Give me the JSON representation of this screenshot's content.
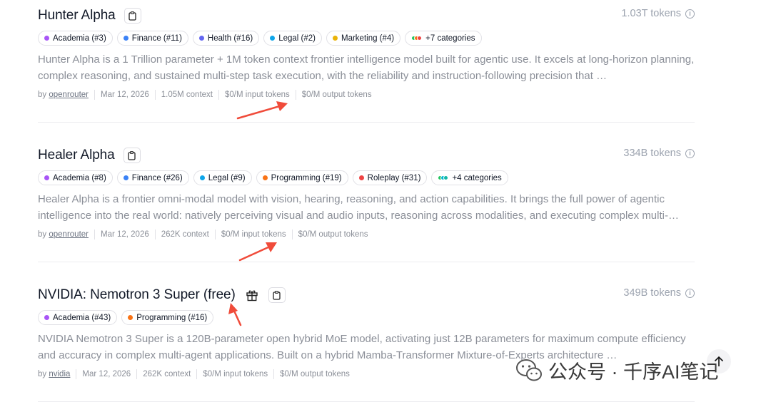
{
  "models": [
    {
      "name": "Hunter Alpha",
      "has_gift_icon": false,
      "tokens": "1.03T tokens",
      "tags": [
        {
          "label": "Academia (#3)",
          "color": "#a855f7"
        },
        {
          "label": "Finance (#11)",
          "color": "#3b82f6"
        },
        {
          "label": "Health (#16)",
          "color": "#6366f1"
        },
        {
          "label": "Legal (#2)",
          "color": "#0ea5e9"
        },
        {
          "label": "Marketing (#4)",
          "color": "#eab308"
        },
        {
          "label": "+7 categories",
          "color": "multi"
        }
      ],
      "description": "Hunter Alpha is a 1 Trillion parameter + 1M token context frontier intelligence model built for agentic use. It excels at long-horizon planning, complex reasoning, and sustained multi-step task execution, with the reliability and instruction-following precision that …",
      "by_label": "by",
      "author": "openrouter",
      "date": "Mar 12, 2026",
      "context": "1.05M context",
      "input_price": "$0/M input tokens",
      "output_price": "$0/M output tokens"
    },
    {
      "name": "Healer Alpha",
      "has_gift_icon": false,
      "tokens": "334B tokens",
      "tags": [
        {
          "label": "Academia (#8)",
          "color": "#a855f7"
        },
        {
          "label": "Finance (#26)",
          "color": "#3b82f6"
        },
        {
          "label": "Legal (#9)",
          "color": "#0ea5e9"
        },
        {
          "label": "Programming (#19)",
          "color": "#f97316"
        },
        {
          "label": "Roleplay (#31)",
          "color": "#ef4444"
        },
        {
          "label": "+4 categories",
          "color": "multi"
        }
      ],
      "description": "Healer Alpha is a frontier omni-modal model with vision, hearing, reasoning, and action capabilities. It brings the full power of agentic intelligence into the real world: natively perceiving visual and audio inputs, reasoning across modalities, and executing complex multi-…",
      "by_label": "by",
      "author": "openrouter",
      "date": "Mar 12, 2026",
      "context": "262K context",
      "input_price": "$0/M input tokens",
      "output_price": "$0/M output tokens"
    },
    {
      "name": "NVIDIA: Nemotron 3 Super (free)",
      "has_gift_icon": true,
      "tokens": "349B tokens",
      "tags": [
        {
          "label": "Academia (#43)",
          "color": "#a855f7"
        },
        {
          "label": "Programming (#16)",
          "color": "#f97316"
        }
      ],
      "description": "NVIDIA Nemotron 3 Super is a 120B-parameter open hybrid MoE model, activating just 12B parameters for maximum compute efficiency and accuracy in complex multi-agent applications. Built on a hybrid Mamba-Transformer Mixture-of-Experts architecture …",
      "by_label": "by",
      "author": "nvidia",
      "date": "Mar 12, 2026",
      "context": "262K context",
      "input_price": "$0/M input tokens",
      "output_price": "$0/M output tokens"
    }
  ],
  "icons": {
    "copy": "clipboard-icon",
    "gift": "gift-icon",
    "info": "info-icon",
    "scroll_top": "arrow-up-icon",
    "annotation": "red-arrow"
  },
  "annotation_color": "#f04b3a",
  "watermark": {
    "text": "公众号 · 千序AI笔记",
    "icon": "wechat-icon"
  }
}
